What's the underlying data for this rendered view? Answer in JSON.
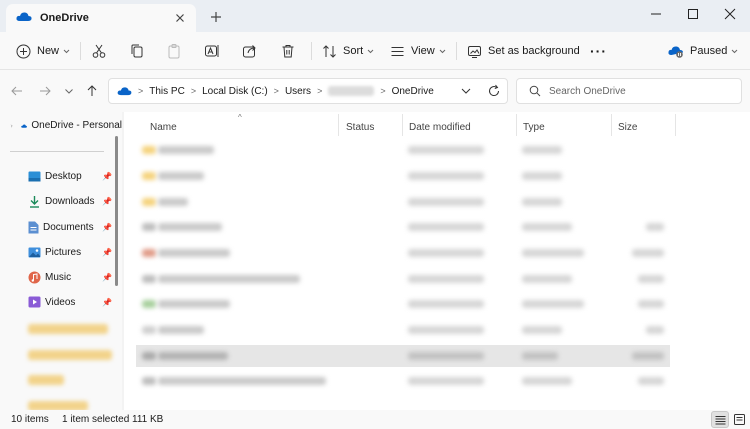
{
  "window": {
    "tab_title": "OneDrive",
    "accent": "#0078d4"
  },
  "toolbar": {
    "new_label": "New",
    "sort_label": "Sort",
    "view_label": "View",
    "set_background_label": "Set as background",
    "sync_status_label": "Paused",
    "more_glyph": "···"
  },
  "address": {
    "crumbs": [
      "This PC",
      "Local Disk (C:)",
      "Users",
      "OneDrive"
    ],
    "separator": ">"
  },
  "search": {
    "placeholder": "Search OneDrive"
  },
  "nav": {
    "top_item": "OneDrive - Personal",
    "items": [
      {
        "label": "Desktop",
        "icon": "desktop-icon"
      },
      {
        "label": "Downloads",
        "icon": "download-icon"
      },
      {
        "label": "Documents",
        "icon": "documents-icon"
      },
      {
        "label": "Pictures",
        "icon": "pictures-icon"
      },
      {
        "label": "Music",
        "icon": "music-icon"
      },
      {
        "label": "Videos",
        "icon": "videos-icon"
      }
    ]
  },
  "columns": {
    "name": "Name",
    "status": "Status",
    "date_modified": "Date modified",
    "type": "Type",
    "size": "Size"
  },
  "status": {
    "item_count": "10 items",
    "selection": "1 item selected",
    "selection_size": "111 KB"
  }
}
